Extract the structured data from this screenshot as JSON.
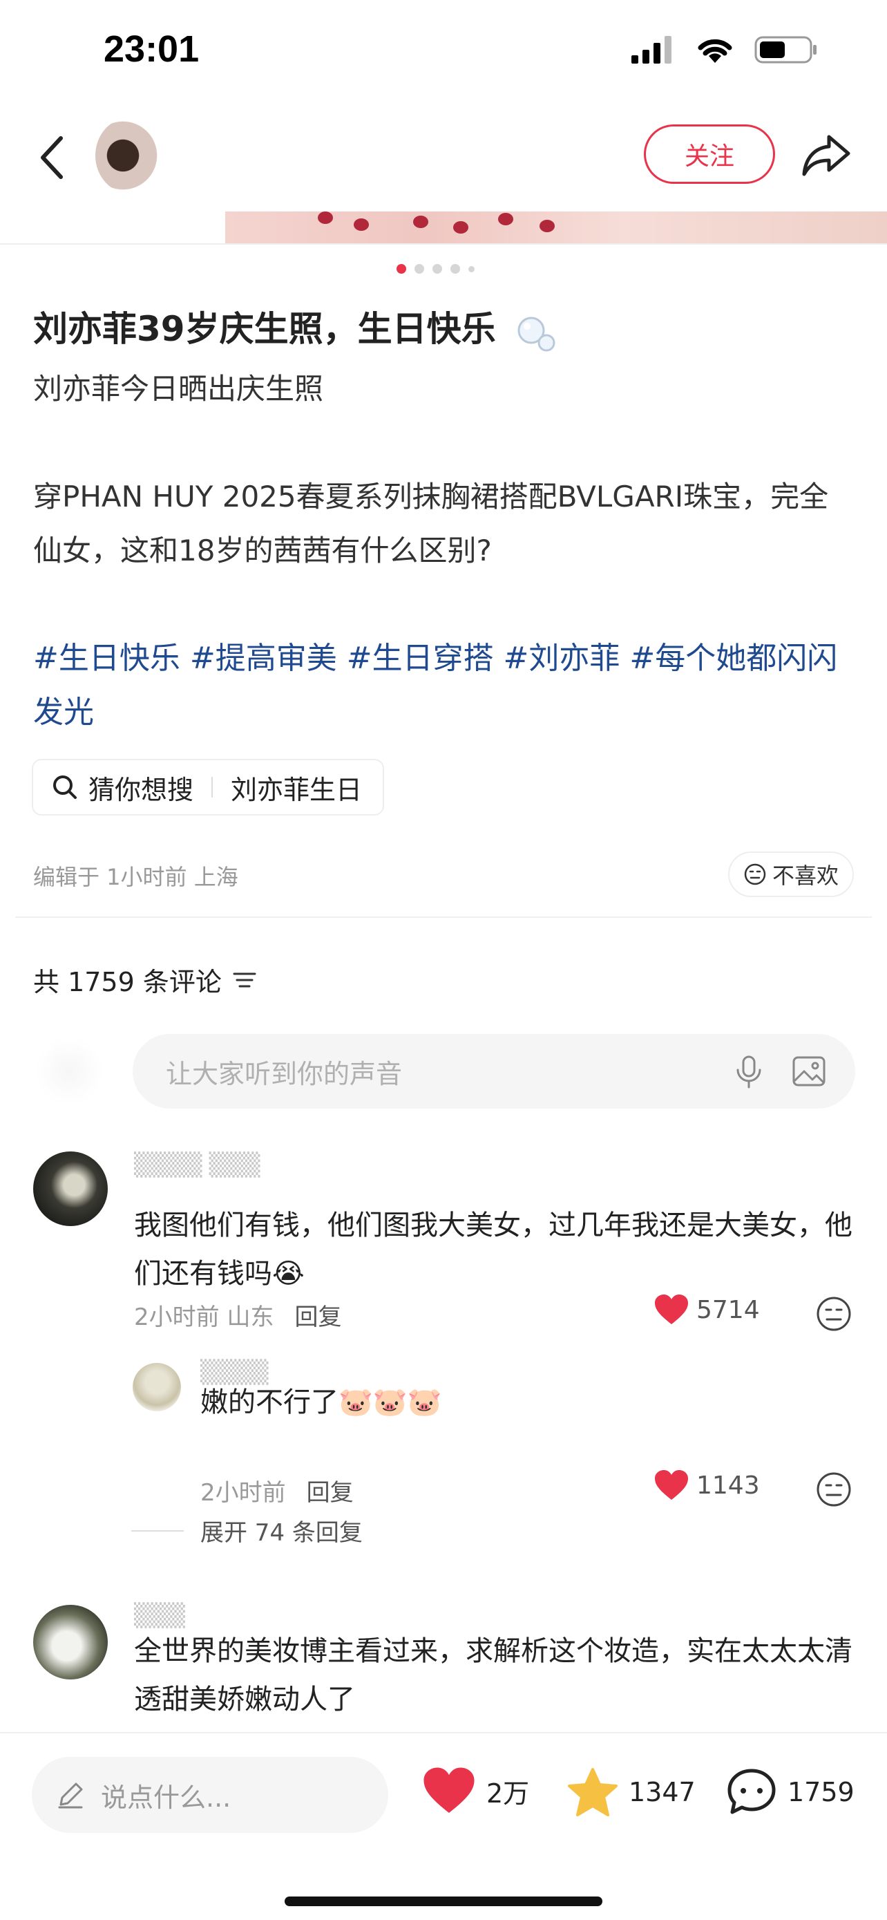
{
  "status_bar": {
    "time": "23:01"
  },
  "header": {
    "follow_label": "关注"
  },
  "post": {
    "title": "刘亦菲39岁庆生照，生日快乐",
    "body_line1": "刘亦菲今日晒出庆生照",
    "body_para2": "穿PHAN HUY 2025春夏系列抹胸裙搭配BVLGARI珠宝，完全仙女，这和18岁的茜茜有什么区别?",
    "tags": "#生日快乐 #提高审美 #生日穿搭 #刘亦菲 #每个她都闪闪发光",
    "search_chip": {
      "label": "猜你想搜",
      "query": "刘亦菲生日"
    },
    "meta": "编辑于 1小时前 上海",
    "dislike_label": "不喜欢"
  },
  "comments_section": {
    "count_label": "共 1759 条评论",
    "input_placeholder": "让大家听到你的声音",
    "comments": [
      {
        "text": "我图他们有钱，他们图我大美女，过几年我还是大美女，他们还有钱吗",
        "emoji": "😭",
        "time_location": "2小时前 山东",
        "reply_label": "回复",
        "likes": "5714"
      },
      {
        "text": "嫩的不行了",
        "emoji": "🐷🐷🐷",
        "time_location": "2小时前",
        "reply_label": "回复",
        "likes": "1143"
      },
      {
        "text": "全世界的美妆博主看过来，求解析这个妆造，实在太太太清透甜美娇嫩动人了"
      }
    ],
    "expand_label": "展开 74 条回复"
  },
  "bottom_bar": {
    "input_placeholder": "说点什么...",
    "likes": "2万",
    "favorites": "1347",
    "comments": "1759"
  },
  "colors": {
    "accent": "#e8334a",
    "tag": "#1f4a8f",
    "star": "#f6c143"
  }
}
